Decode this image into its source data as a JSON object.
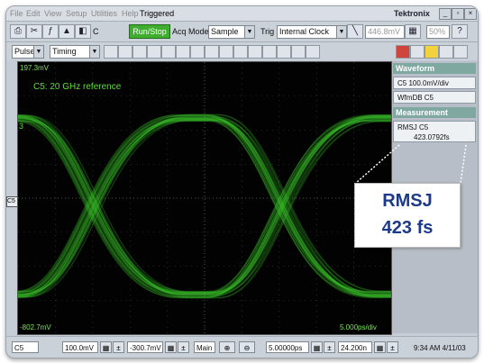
{
  "menu": {
    "items": [
      "File",
      "Edit",
      "View",
      "Setup",
      "Utilities",
      "Help"
    ],
    "active_item": "Triggered",
    "brand": "Tektronix"
  },
  "toolbar": {
    "c_label": "C",
    "run_stop": "Run/Stop",
    "acq_mode_label": "Acq Mode",
    "acq_mode_value": "Sample",
    "trig_label": "Trig",
    "trig_value": "Internal Clock",
    "trig_level": "446.8mV",
    "zoom": "50%"
  },
  "toolbar2": {
    "mode_value": "Pulse",
    "meas_value": "Timing"
  },
  "scope": {
    "top_level": "197.3mV",
    "bottom_level": "-802.7mV",
    "time_div": "5.000ps/div",
    "reference_label": "C5: 20 GHz reference",
    "channel_marker": "C5",
    "waveform_color": "#3ec62c"
  },
  "sidebar": {
    "waveform_header": "Waveform",
    "waveform_item1": "C5 100.0mV/div",
    "waveform_item2": "WfmDB C5",
    "measurement_header": "Measurement",
    "meas_item_line1": "RMSJ C5",
    "meas_item_line2": "423.0792fs"
  },
  "callout": {
    "line1": "RMSJ",
    "line2": "423 fs"
  },
  "status": {
    "channel": "C5",
    "volts_div": "100.0mV",
    "offset": "-300.7mV",
    "main_label": "Main",
    "time_div": "5.00000ps",
    "position": "24.200n",
    "datetime": "9:34 AM 4/11/03"
  }
}
